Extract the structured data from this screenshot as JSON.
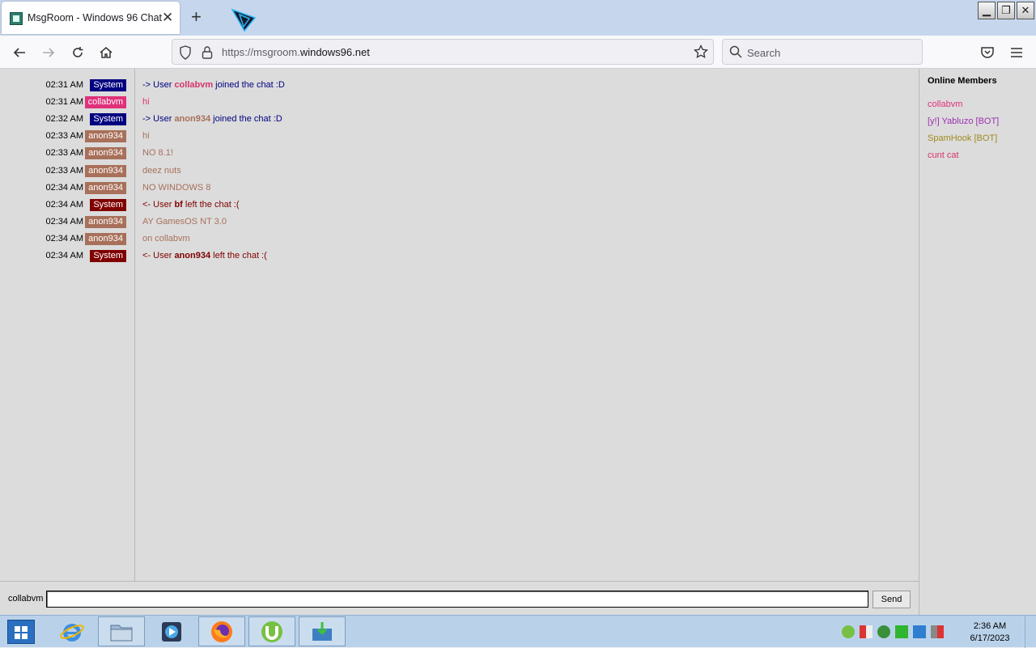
{
  "browser": {
    "tab_title": "MsgRoom - Windows 96 Chat",
    "url_prefix": "https://msgroom.",
    "url_host": "windows96.net",
    "search_placeholder": "Search"
  },
  "chat": {
    "messages": [
      {
        "time": "02:31 AM",
        "user": "System",
        "badge_color": "#000080",
        "text_color": "#000080",
        "pre": "-> User ",
        "bold": "collabvm",
        "bold_color": "#d6336c",
        "post": " joined the chat :D"
      },
      {
        "time": "02:31 AM",
        "user": "collabvm",
        "badge_color": "#e0317a",
        "text_color": "#e0317a",
        "pre": "hi",
        "bold": "",
        "bold_color": "",
        "post": ""
      },
      {
        "time": "02:32 AM",
        "user": "System",
        "badge_color": "#000080",
        "text_color": "#000080",
        "pre": "-> User ",
        "bold": "anon934",
        "bold_color": "#a8705a",
        "post": " joined the chat :D"
      },
      {
        "time": "02:33 AM",
        "user": "anon934",
        "badge_color": "#a8705a",
        "text_color": "#a8705a",
        "pre": "hi",
        "bold": "",
        "bold_color": "",
        "post": ""
      },
      {
        "time": "02:33 AM",
        "user": "anon934",
        "badge_color": "#a8705a",
        "text_color": "#a8705a",
        "pre": "NO 8.1!",
        "bold": "",
        "bold_color": "",
        "post": ""
      },
      {
        "time": "02:33 AM",
        "user": "anon934",
        "badge_color": "#a8705a",
        "text_color": "#a8705a",
        "pre": "deez nuts",
        "bold": "",
        "bold_color": "",
        "post": ""
      },
      {
        "time": "02:34 AM",
        "user": "anon934",
        "badge_color": "#a8705a",
        "text_color": "#a8705a",
        "pre": "NO WINDOWS 8",
        "bold": "",
        "bold_color": "",
        "post": ""
      },
      {
        "time": "02:34 AM",
        "user": "System",
        "badge_color": "#800000",
        "text_color": "#800000",
        "pre": "<- User ",
        "bold": "bf",
        "bold_color": "#800000",
        "post": " left the chat :("
      },
      {
        "time": "02:34 AM",
        "user": "anon934",
        "badge_color": "#a8705a",
        "text_color": "#a8705a",
        "pre": "AY GamesOS NT 3.0",
        "bold": "",
        "bold_color": "",
        "post": ""
      },
      {
        "time": "02:34 AM",
        "user": "anon934",
        "badge_color": "#a8705a",
        "text_color": "#a8705a",
        "pre": "on collabvm",
        "bold": "",
        "bold_color": "",
        "post": ""
      },
      {
        "time": "02:34 AM",
        "user": "System",
        "badge_color": "#800000",
        "text_color": "#800000",
        "pre": "<- User ",
        "bold": "anon934",
        "bold_color": "#800000",
        "post": " left the chat :("
      }
    ]
  },
  "members": {
    "title": "Online Members",
    "list": [
      {
        "name": "collabvm",
        "color": "#e0317a"
      },
      {
        "name": "[y!] Yabluzo [BOT]",
        "color": "#9b30b0"
      },
      {
        "name": "SpamHook [BOT]",
        "color": "#a08a20"
      },
      {
        "name": "cunt cat",
        "color": "#d6336c"
      }
    ]
  },
  "composer": {
    "nickname": "collabvm",
    "input_value": "",
    "send_label": "Send"
  },
  "taskbar": {
    "apps": [
      "internet-explorer",
      "file-explorer",
      "media-player",
      "firefox",
      "utorrent",
      "downloader"
    ],
    "time": "2:36 AM",
    "date": "6/17/2023"
  }
}
